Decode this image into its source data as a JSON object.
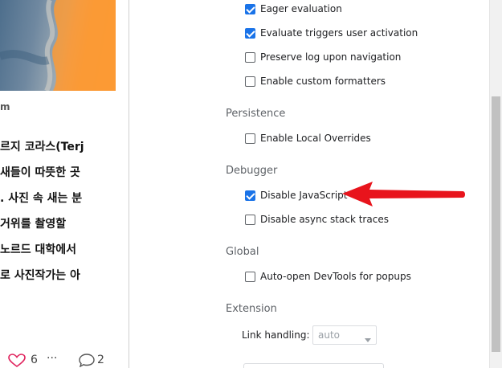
{
  "page": {
    "author_snippet": "m",
    "article_lines": [
      "르지 코라스(Terj",
      "새들이 따뜻한 곳",
      ". 사진 속 새는 분",
      "  거위를 촬영할",
      "노르드 대학에서",
      "로 사진작가는 아"
    ],
    "like_count": "6",
    "more_label": "···",
    "comment_count": "2"
  },
  "settings": {
    "console_items": [
      {
        "label": "Eager evaluation",
        "checked": true
      },
      {
        "label": "Evaluate triggers user activation",
        "checked": true
      },
      {
        "label": "Preserve log upon navigation",
        "checked": false
      },
      {
        "label": "Enable custom formatters",
        "checked": false
      }
    ],
    "persistence": {
      "title": "Persistence",
      "items": [
        {
          "label": "Enable Local Overrides",
          "checked": false
        }
      ]
    },
    "debugger": {
      "title": "Debugger",
      "items": [
        {
          "label": "Disable JavaScript",
          "checked": true
        },
        {
          "label": "Disable async stack traces",
          "checked": false
        }
      ]
    },
    "global": {
      "title": "Global",
      "items": [
        {
          "label": "Auto-open DevTools for popups",
          "checked": false
        }
      ]
    },
    "extension": {
      "title": "Extension",
      "link_handling_label": "Link handling:",
      "link_handling_value": "auto"
    }
  },
  "colors": {
    "checkbox_checked": "#1a73e8",
    "annotation_arrow": "#e8141c",
    "section_title": "#5f6368"
  },
  "icons": [
    "heart-icon",
    "more-icon",
    "comment-icon",
    "checkbox-icon",
    "chevron-down-icon",
    "arrow-left-icon"
  ]
}
